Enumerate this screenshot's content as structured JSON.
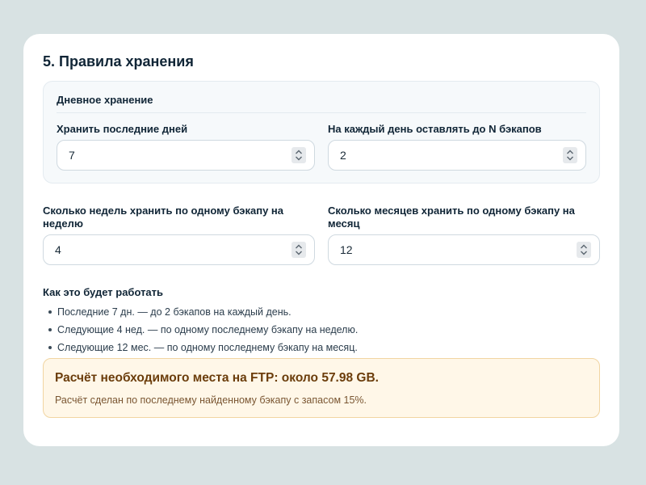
{
  "section": {
    "title": "5. Правила хранения"
  },
  "daily": {
    "heading": "Дневное хранение",
    "days_label": "Хранить последние дней",
    "days_value": "7",
    "per_day_label": "На каждый день оставлять до N бэкапов",
    "per_day_value": "2"
  },
  "weekly": {
    "label": "Сколько недель хранить по одному бэкапу на неделю",
    "value": "4"
  },
  "monthly": {
    "label": "Сколько месяцев хранить по одному бэкапу на месяц",
    "value": "12"
  },
  "how": {
    "title": "Как это будет работать",
    "items": [
      "Последние 7 дн. — до 2 бэкапов на каждый день.",
      "Следующие 4 нед. — по одному последнему бэкапу на неделю.",
      "Следующие 12 мес. — по одному последнему бэкапу на месяц."
    ]
  },
  "estimate": {
    "title": "Расчёт необходимого места на FTP: около 57.98 GB.",
    "note": "Расчёт сделан по последнему найденному бэкапу с запасом 15%."
  },
  "icons": {
    "spinner": "up-down-chevron-icon",
    "bullet": "bullet-dot"
  },
  "colors": {
    "background": "#d8e2e3",
    "card": "#ffffff",
    "estimate_bg": "#fff7e8",
    "estimate_border": "#f1d5a2",
    "estimate_title": "#6b3d0b"
  }
}
